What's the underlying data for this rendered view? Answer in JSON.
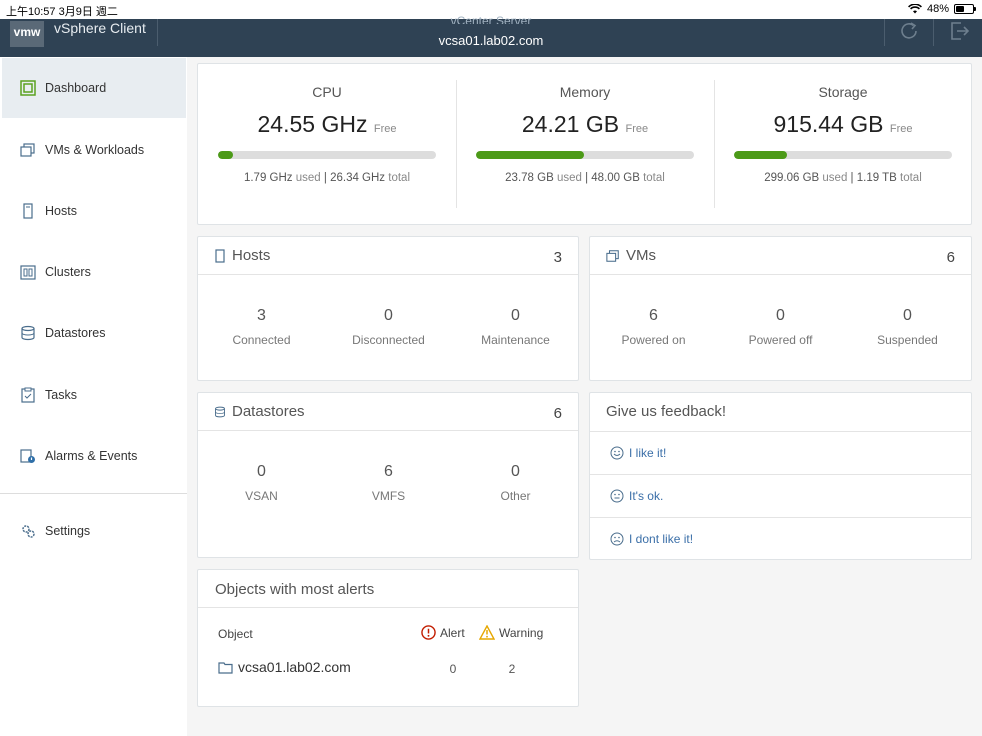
{
  "status_bar": {
    "time_date": "上午10:57   3月9日 週二",
    "battery": "48%",
    "battery_level": 0.48
  },
  "header": {
    "logo": "vmw",
    "app_name": "vSphere Client",
    "server_label": "vCenter Server",
    "server_host": "vcsa01.lab02.com"
  },
  "sidebar": {
    "items": [
      {
        "label": "Dashboard",
        "icon": "dashboard-icon"
      },
      {
        "label": "VMs & Workloads",
        "icon": "vm-icon"
      },
      {
        "label": "Hosts",
        "icon": "host-icon"
      },
      {
        "label": "Clusters",
        "icon": "cluster-icon"
      },
      {
        "label": "Datastores",
        "icon": "datastore-icon"
      },
      {
        "label": "Tasks",
        "icon": "tasks-icon"
      },
      {
        "label": "Alarms & Events",
        "icon": "alarm-icon"
      },
      {
        "label": "Settings",
        "icon": "gear-icon"
      }
    ]
  },
  "resources": {
    "cpu": {
      "title": "CPU",
      "free": "24.55 GHz",
      "free_label": "Free",
      "used": "1.79 GHz",
      "used_label": "used",
      "total": "26.34 GHz",
      "total_label": "total",
      "used_fraction": 0.068
    },
    "memory": {
      "title": "Memory",
      "free": "24.21 GB",
      "free_label": "Free",
      "used": "23.78 GB",
      "used_label": "used",
      "total": "48.00 GB",
      "total_label": "total",
      "used_fraction": 0.495
    },
    "storage": {
      "title": "Storage",
      "free": "915.44 GB",
      "free_label": "Free",
      "used": "299.06 GB",
      "used_label": "used",
      "total": "1.19 TB",
      "total_label": "total",
      "used_fraction": 0.245
    }
  },
  "hosts": {
    "title": "Hosts",
    "count": "3",
    "stats": [
      {
        "value": "3",
        "label": "Connected"
      },
      {
        "value": "0",
        "label": "Disconnected"
      },
      {
        "value": "0",
        "label": "Maintenance"
      }
    ]
  },
  "vms": {
    "title": "VMs",
    "count": "6",
    "stats": [
      {
        "value": "6",
        "label": "Powered on"
      },
      {
        "value": "0",
        "label": "Powered off"
      },
      {
        "value": "0",
        "label": "Suspended"
      }
    ]
  },
  "datastores": {
    "title": "Datastores",
    "count": "6",
    "stats": [
      {
        "value": "0",
        "label": "VSAN"
      },
      {
        "value": "6",
        "label": "VMFS"
      },
      {
        "value": "0",
        "label": "Other"
      }
    ]
  },
  "feedback": {
    "title": "Give us feedback!",
    "options": [
      "I like it!",
      "It's ok.",
      "I dont like it!"
    ]
  },
  "alerts": {
    "title": "Objects with most alerts",
    "col_object": "Object",
    "col_alert": "Alert",
    "col_warning": "Warning",
    "rows": [
      {
        "object": "vcsa01.lab02.com",
        "alert": "0",
        "warning": "2"
      }
    ]
  }
}
